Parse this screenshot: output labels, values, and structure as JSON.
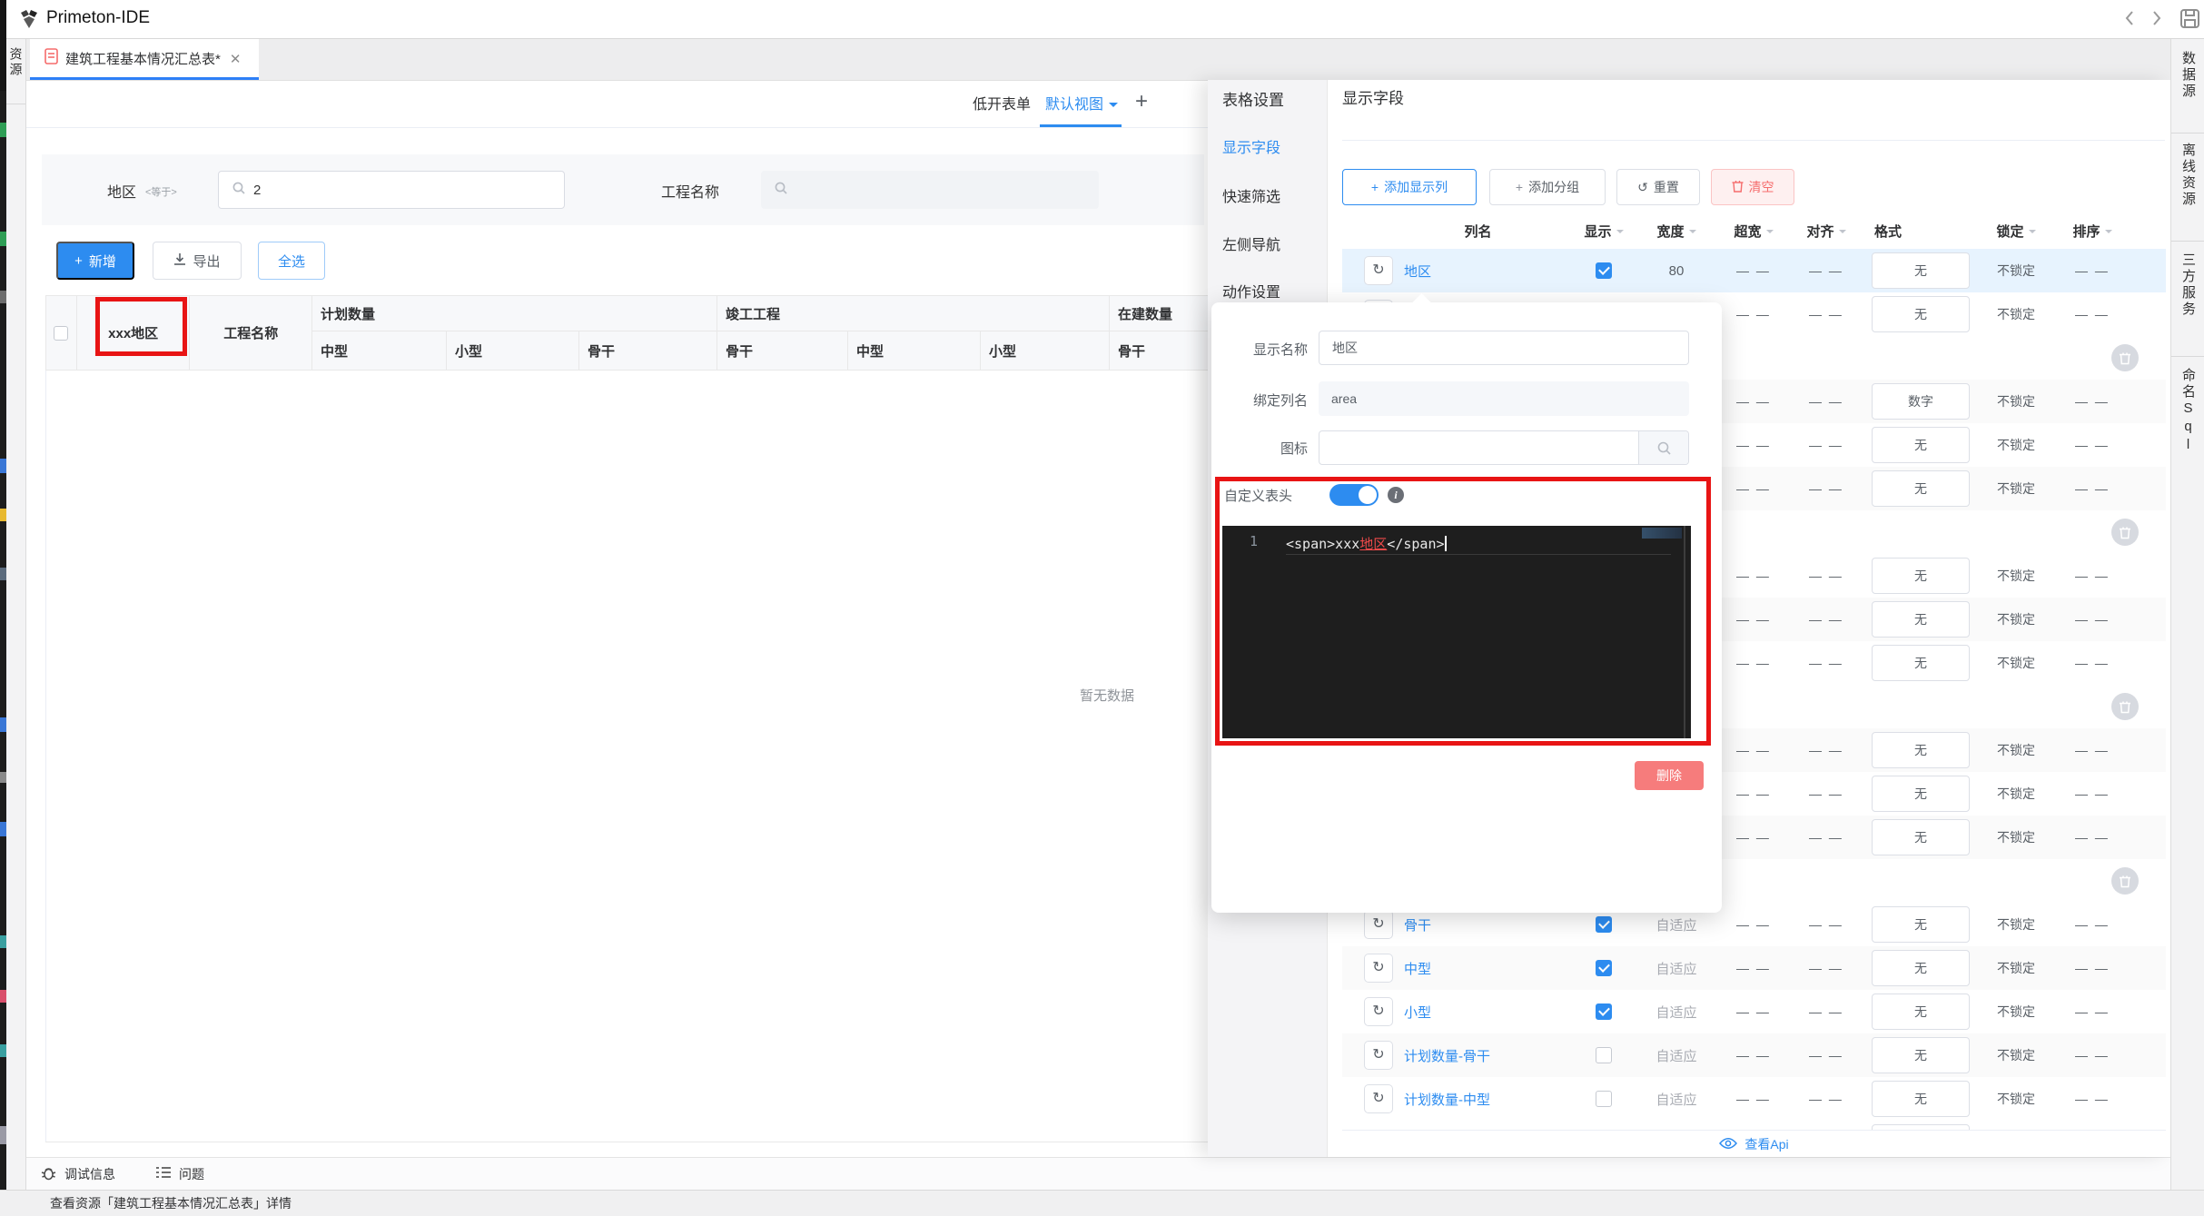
{
  "window": {
    "title": "Primeton-IDE"
  },
  "tab": {
    "label": "建筑工程基本情况汇总表*"
  },
  "left_rail": {
    "items": [
      "资源"
    ]
  },
  "right_rail": {
    "items": [
      "数据源",
      "离线资源",
      "三方服务",
      "命名Sql"
    ]
  },
  "toolbar": {
    "form_tab": "低开表单",
    "view_tab": "默认视图",
    "add_view": "+"
  },
  "filters": {
    "area_label": "地区",
    "area_op": "<等于>",
    "area_value": "2",
    "project_label": "工程名称",
    "project_value": ""
  },
  "actions": {
    "add": "新增",
    "export": "导出",
    "select_all": "全选"
  },
  "main_table": {
    "area_header": "xxx地区",
    "project_header": "工程名称",
    "groups": [
      {
        "label": "计划数量",
        "children": [
          "中型",
          "小型",
          "骨干"
        ]
      },
      {
        "label": "竣工工程",
        "children": [
          "骨干",
          "中型",
          "小型"
        ]
      },
      {
        "label": "在建数量",
        "children": [
          "骨干"
        ]
      }
    ],
    "empty": "暂无数据"
  },
  "settings": {
    "menu_title": "表格设置",
    "menu": [
      {
        "label": "显示字段"
      },
      {
        "label": "快速筛选"
      },
      {
        "label": "左侧导航"
      },
      {
        "label": "动作设置"
      }
    ],
    "content_title": "显示字段",
    "buttons": {
      "add_column": "添加显示列",
      "add_group": "添加分组",
      "reset": "重置",
      "clear": "清空"
    },
    "columns": [
      "列名",
      "显示",
      "宽度",
      "超宽",
      "对齐",
      "格式",
      "锁定",
      "排序"
    ],
    "rows": [
      {
        "kind": "field",
        "name": "地区",
        "width": "80",
        "wide": "— —",
        "align": "— —",
        "format": "无",
        "lock": "不锁定",
        "sort": "— —"
      },
      {
        "kind": "field",
        "name": "",
        "width": "",
        "wide": "— —",
        "align": "— —",
        "format": "无",
        "lock": "不锁定",
        "sort": "— —"
      },
      {
        "kind": "group"
      },
      {
        "kind": "field",
        "name": "",
        "width": "",
        "wide": "— —",
        "align": "— —",
        "format": "数字",
        "lock": "不锁定",
        "sort": "— —"
      },
      {
        "kind": "field",
        "name": "",
        "width": "",
        "wide": "— —",
        "align": "— —",
        "format": "无",
        "lock": "不锁定",
        "sort": "— —"
      },
      {
        "kind": "field",
        "name": "",
        "width": "",
        "wide": "— —",
        "align": "— —",
        "format": "无",
        "lock": "不锁定",
        "sort": "— —"
      },
      {
        "kind": "group"
      },
      {
        "kind": "field",
        "name": "",
        "width": "",
        "wide": "— —",
        "align": "— —",
        "format": "无",
        "lock": "不锁定",
        "sort": "— —"
      },
      {
        "kind": "field",
        "name": "",
        "width": "",
        "wide": "— —",
        "align": "— —",
        "format": "无",
        "lock": "不锁定",
        "sort": "— —"
      },
      {
        "kind": "field",
        "name": "",
        "width": "",
        "wide": "— —",
        "align": "— —",
        "format": "无",
        "lock": "不锁定",
        "sort": "— —"
      },
      {
        "kind": "group"
      },
      {
        "kind": "field",
        "name": "",
        "width": "",
        "wide": "— —",
        "align": "— —",
        "format": "无",
        "lock": "不锁定",
        "sort": "— —"
      },
      {
        "kind": "field",
        "name": "",
        "width": "",
        "wide": "— —",
        "align": "— —",
        "format": "无",
        "lock": "不锁定",
        "sort": "— —"
      },
      {
        "kind": "field",
        "name": "",
        "width": "",
        "wide": "— —",
        "align": "— —",
        "format": "无",
        "lock": "不锁定",
        "sort": "— —"
      },
      {
        "kind": "group"
      },
      {
        "kind": "field",
        "name": "骨干",
        "width": "自适应",
        "wide": "— —",
        "align": "— —",
        "format": "无",
        "lock": "不锁定",
        "sort": "— —"
      },
      {
        "kind": "field",
        "name": "中型",
        "width": "自适应",
        "wide": "— —",
        "align": "— —",
        "format": "无",
        "lock": "不锁定",
        "sort": "— —"
      },
      {
        "kind": "field",
        "name": "小型",
        "width": "自适应",
        "wide": "— —",
        "align": "— —",
        "format": "无",
        "lock": "不锁定",
        "sort": "— —"
      },
      {
        "kind": "field",
        "name": "计划数量-骨干",
        "width": "自适应",
        "wide": "— —",
        "align": "— —",
        "format": "无",
        "lock": "不锁定",
        "sort": "— —"
      },
      {
        "kind": "field",
        "name": "计划数量-中型",
        "width": "自适应",
        "wide": "— —",
        "align": "— —",
        "format": "无",
        "lock": "不锁定",
        "sort": "— —"
      },
      {
        "kind": "partial"
      }
    ],
    "view_api": "查看Api"
  },
  "popup": {
    "display_name_label": "显示名称",
    "display_name_value": "地区",
    "bind_column_label": "绑定列名",
    "bind_column_value": "area",
    "icon_label": "图标",
    "icon_value": "",
    "custom_header_label": "自定义表头",
    "code_line_number": "1",
    "code": {
      "before": "<span>xxx",
      "highlight": "地区",
      "after": "</span>"
    },
    "delete_label": "删除"
  },
  "bottom": {
    "debug": "调试信息",
    "problems": "问题",
    "status": "查看资源「建筑工程基本情况汇总表」详情"
  },
  "colors": {
    "accent": "#2d8cf0",
    "danger": "#f56c6c",
    "annotation_red": "#e81414",
    "editor_bg": "#1e1e1e",
    "selected_row": "#e7f3fe",
    "code_highlight": "#f04a4a"
  },
  "icons": [
    "app-logo",
    "back-chevron",
    "forward-chevron",
    "save-floppy",
    "document",
    "close-x",
    "search-magnifier",
    "plus",
    "download",
    "refresh",
    "trash",
    "reset-arrow",
    "toggle-on",
    "info",
    "eye",
    "bug",
    "list",
    "caret-down"
  ]
}
